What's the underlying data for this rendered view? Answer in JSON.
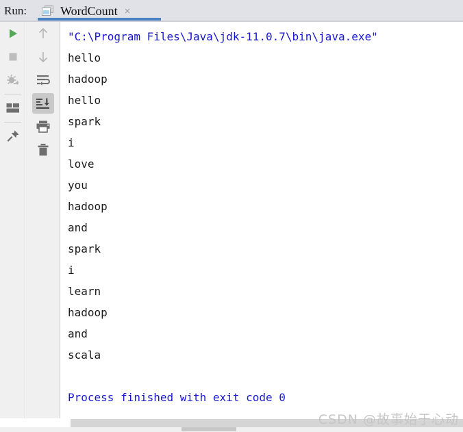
{
  "header": {
    "run_label": "Run:",
    "tab": {
      "title": "WordCount",
      "close_label": "×",
      "icon": "run-configuration-icon"
    }
  },
  "toolbar_primary": {
    "items": [
      {
        "name": "rerun-button",
        "icon": "play-icon",
        "tooltip": "Rerun"
      },
      {
        "name": "stop-button",
        "icon": "stop-square-icon",
        "tooltip": "Stop"
      },
      {
        "name": "rerun-failed-tests-button",
        "icon": "bug-rerun-icon",
        "tooltip": "Rerun Failed Tests"
      },
      {
        "name": "layout-settings-button",
        "icon": "layout-grid-icon",
        "tooltip": "Layout Settings"
      },
      {
        "name": "pin-tab-button",
        "icon": "pin-icon",
        "tooltip": "Pin Tab"
      }
    ]
  },
  "toolbar_secondary": {
    "items": [
      {
        "name": "up-the-stack-trace-button",
        "icon": "arrow-up-icon",
        "tooltip": "Up the Stack Trace"
      },
      {
        "name": "down-the-stack-trace-button",
        "icon": "arrow-down-icon",
        "tooltip": "Down the Stack Trace"
      },
      {
        "name": "soft-wrap-button",
        "icon": "soft-wrap-icon",
        "tooltip": "Soft-Wrap"
      },
      {
        "name": "scroll-to-end-button",
        "icon": "scroll-to-end-icon",
        "tooltip": "Scroll to End",
        "active": true
      },
      {
        "name": "print-button",
        "icon": "printer-icon",
        "tooltip": "Print"
      },
      {
        "name": "clear-all-button",
        "icon": "trash-icon",
        "tooltip": "Clear All"
      }
    ]
  },
  "console": {
    "lines": [
      {
        "text": "\"C:\\Program Files\\Java\\jdk-11.0.7\\bin\\java.exe\"",
        "type": "cmd"
      },
      {
        "text": "hello",
        "type": "out"
      },
      {
        "text": "hadoop",
        "type": "out"
      },
      {
        "text": "hello",
        "type": "out"
      },
      {
        "text": "spark",
        "type": "out"
      },
      {
        "text": "i",
        "type": "out"
      },
      {
        "text": "love",
        "type": "out"
      },
      {
        "text": "you",
        "type": "out"
      },
      {
        "text": "hadoop",
        "type": "out"
      },
      {
        "text": "and",
        "type": "out"
      },
      {
        "text": "spark",
        "type": "out"
      },
      {
        "text": "i",
        "type": "out"
      },
      {
        "text": "learn",
        "type": "out"
      },
      {
        "text": "hadoop",
        "type": "out"
      },
      {
        "text": "and",
        "type": "out"
      },
      {
        "text": "scala",
        "type": "out"
      },
      {
        "text": " ",
        "type": "blank"
      },
      {
        "text": "Process finished with exit code 0",
        "type": "cmd"
      }
    ]
  },
  "watermark": {
    "text": "CSDN @故事始于心动"
  },
  "colors": {
    "header_bg": "#e0e2e8",
    "tab_underline": "#4a81c4",
    "toolbar_bg": "#f0f0f0",
    "console_bg": "#ffffff",
    "command_text": "#1818cf",
    "output_text": "#1b1b1b",
    "play_green": "#55a855",
    "icon_gray": "#6e6e6e",
    "icon_light_gray": "#b4b4b4",
    "active_btn_bg": "#c9c9c9",
    "watermark": "#c6c6c6"
  }
}
